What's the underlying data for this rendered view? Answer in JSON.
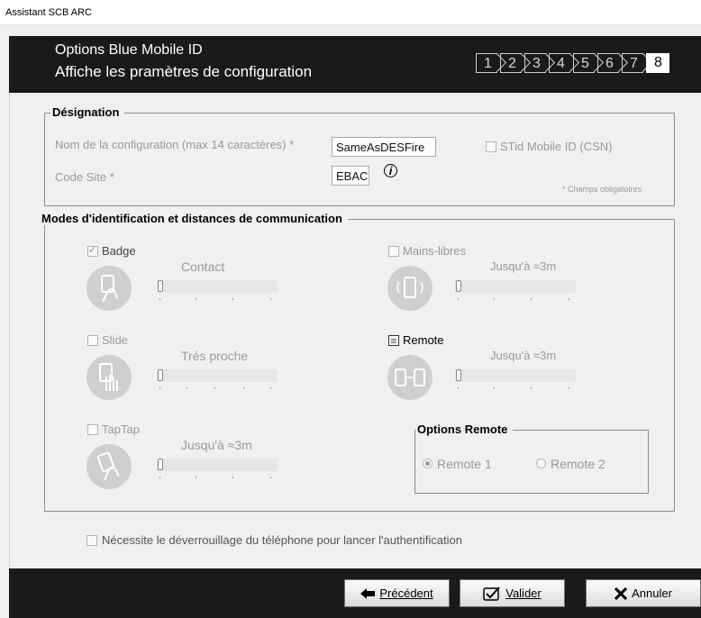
{
  "window": {
    "title": "Assistant SCB ARC"
  },
  "banner": {
    "title": "Options Blue Mobile ID",
    "subtitle": "Affiche les pramètres de configuration",
    "steps": [
      "1",
      "2",
      "3",
      "4",
      "5",
      "6",
      "7",
      "8"
    ],
    "active_step": "8"
  },
  "designation": {
    "legend": "Désignation",
    "config_name_label": "Nom de la configuration (max 14 caractères) *",
    "config_name_value": "SameAsDESFire",
    "site_code_label": "Code Site *",
    "site_code_value": "EBAC",
    "stid_label": "STid Mobile ID (CSN)",
    "required_note": "* Champs obligatoires"
  },
  "modes": {
    "legend": "Modes d'identification et distances de communication",
    "badge": {
      "label": "Badge",
      "distance": "Contact",
      "checked": true,
      "icon": "card-hand-icon"
    },
    "mains_libres": {
      "label": "Mains-libres",
      "distance": "Jusqu'à ≈3m",
      "checked": false,
      "icon": "phone-waves-icon"
    },
    "slide": {
      "label": "Slide",
      "distance": "Trés proche",
      "checked": false,
      "icon": "hand-slide-icon"
    },
    "remote": {
      "label": "Remote",
      "distance": "Jusqu'à ≈3m",
      "checked": true,
      "icon": "remote-phone-icon"
    },
    "taptap": {
      "label": "TapTap",
      "distance": "Jusqu'à ≈3m",
      "checked": false,
      "icon": "hand-tap-icon"
    }
  },
  "remote_options": {
    "legend": "Options Remote",
    "remote1": "Remote 1",
    "remote2": "Remote 2",
    "selected": "Remote 1"
  },
  "unlock_label": "Nécessite le déverrouillage du téléphone pour lancer l'authentification",
  "buttons": {
    "previous": "Précédent",
    "validate": "Valider",
    "cancel": "Annuler"
  }
}
